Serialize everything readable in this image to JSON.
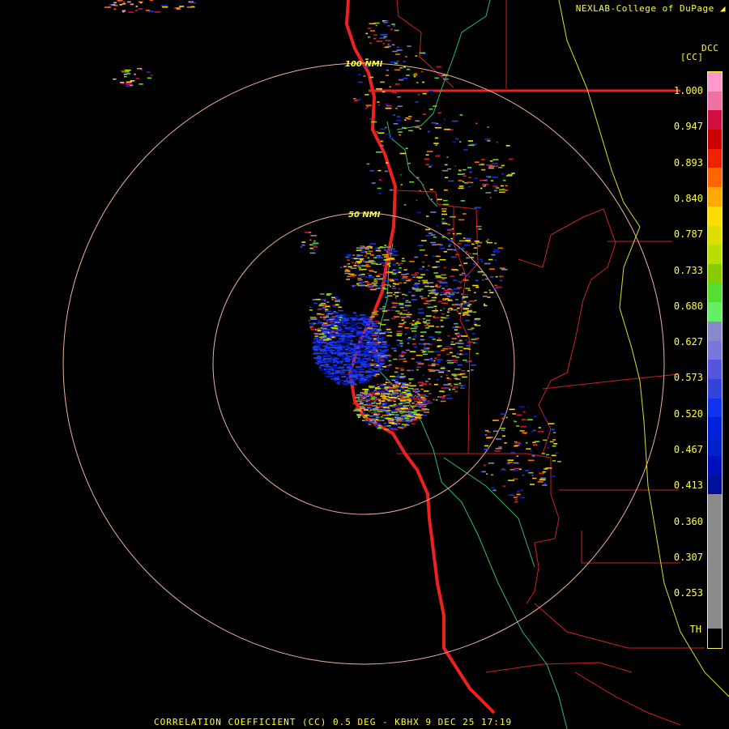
{
  "header": {
    "credit": "NEXLAB-College of DuPage"
  },
  "footer": {
    "caption": "CORRELATION COEFFICIENT (CC) 0.5 DEG - KBHX 9 DEC 25 17:19"
  },
  "legend": {
    "title": "DCC",
    "unit": "[CC]",
    "ticks": [
      "1.000",
      "0.947",
      "0.893",
      "0.840",
      "0.787",
      "0.733",
      "0.680",
      "0.627",
      "0.573",
      "0.520",
      "0.467",
      "0.413",
      "0.360",
      "0.307",
      "0.253",
      "TH"
    ],
    "colors": [
      "#ff99cc",
      "#f070a0",
      "#d01040",
      "#cc0000",
      "#ee2200",
      "#ff6600",
      "#ffaa00",
      "#ffdd00",
      "#dddd00",
      "#bbdd00",
      "#88cc00",
      "#55dd33",
      "#66ee66",
      "#8888cc",
      "#7777dd",
      "#5555dd",
      "#3344dd",
      "#1133ee",
      "#0022dd",
      "#0022cc",
      "#0011bb",
      "#001199",
      "#8a8a8a",
      "#8a8a8a",
      "#8a8a8a",
      "#8a8a8a",
      "#8a8a8a",
      "#8a8a8a",
      "#8a8a8a",
      "#000000"
    ]
  },
  "map": {
    "range_rings": [
      {
        "label": "50 NMI",
        "range_nmi": 50
      },
      {
        "label": "100 NMI",
        "range_nmi": 100
      }
    ]
  }
}
